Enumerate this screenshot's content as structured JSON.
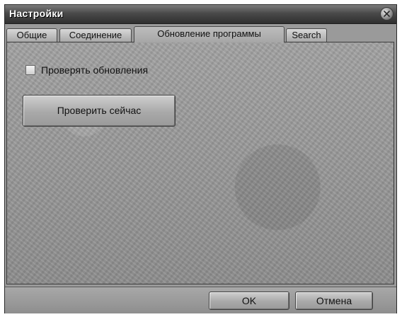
{
  "window": {
    "title": "Настройки"
  },
  "tabs": [
    {
      "label": "Общие",
      "active": false
    },
    {
      "label": "Соединение",
      "active": false
    },
    {
      "label": "Обновление программы",
      "active": true
    },
    {
      "label": "Search",
      "active": false
    }
  ],
  "update_panel": {
    "check_updates_label": "Проверять обновления",
    "check_updates_checked": false,
    "check_now_label": "Проверить сейчас"
  },
  "footer": {
    "ok_label": "OK",
    "cancel_label": "Отмена"
  },
  "icons": {
    "close": "close-icon"
  }
}
